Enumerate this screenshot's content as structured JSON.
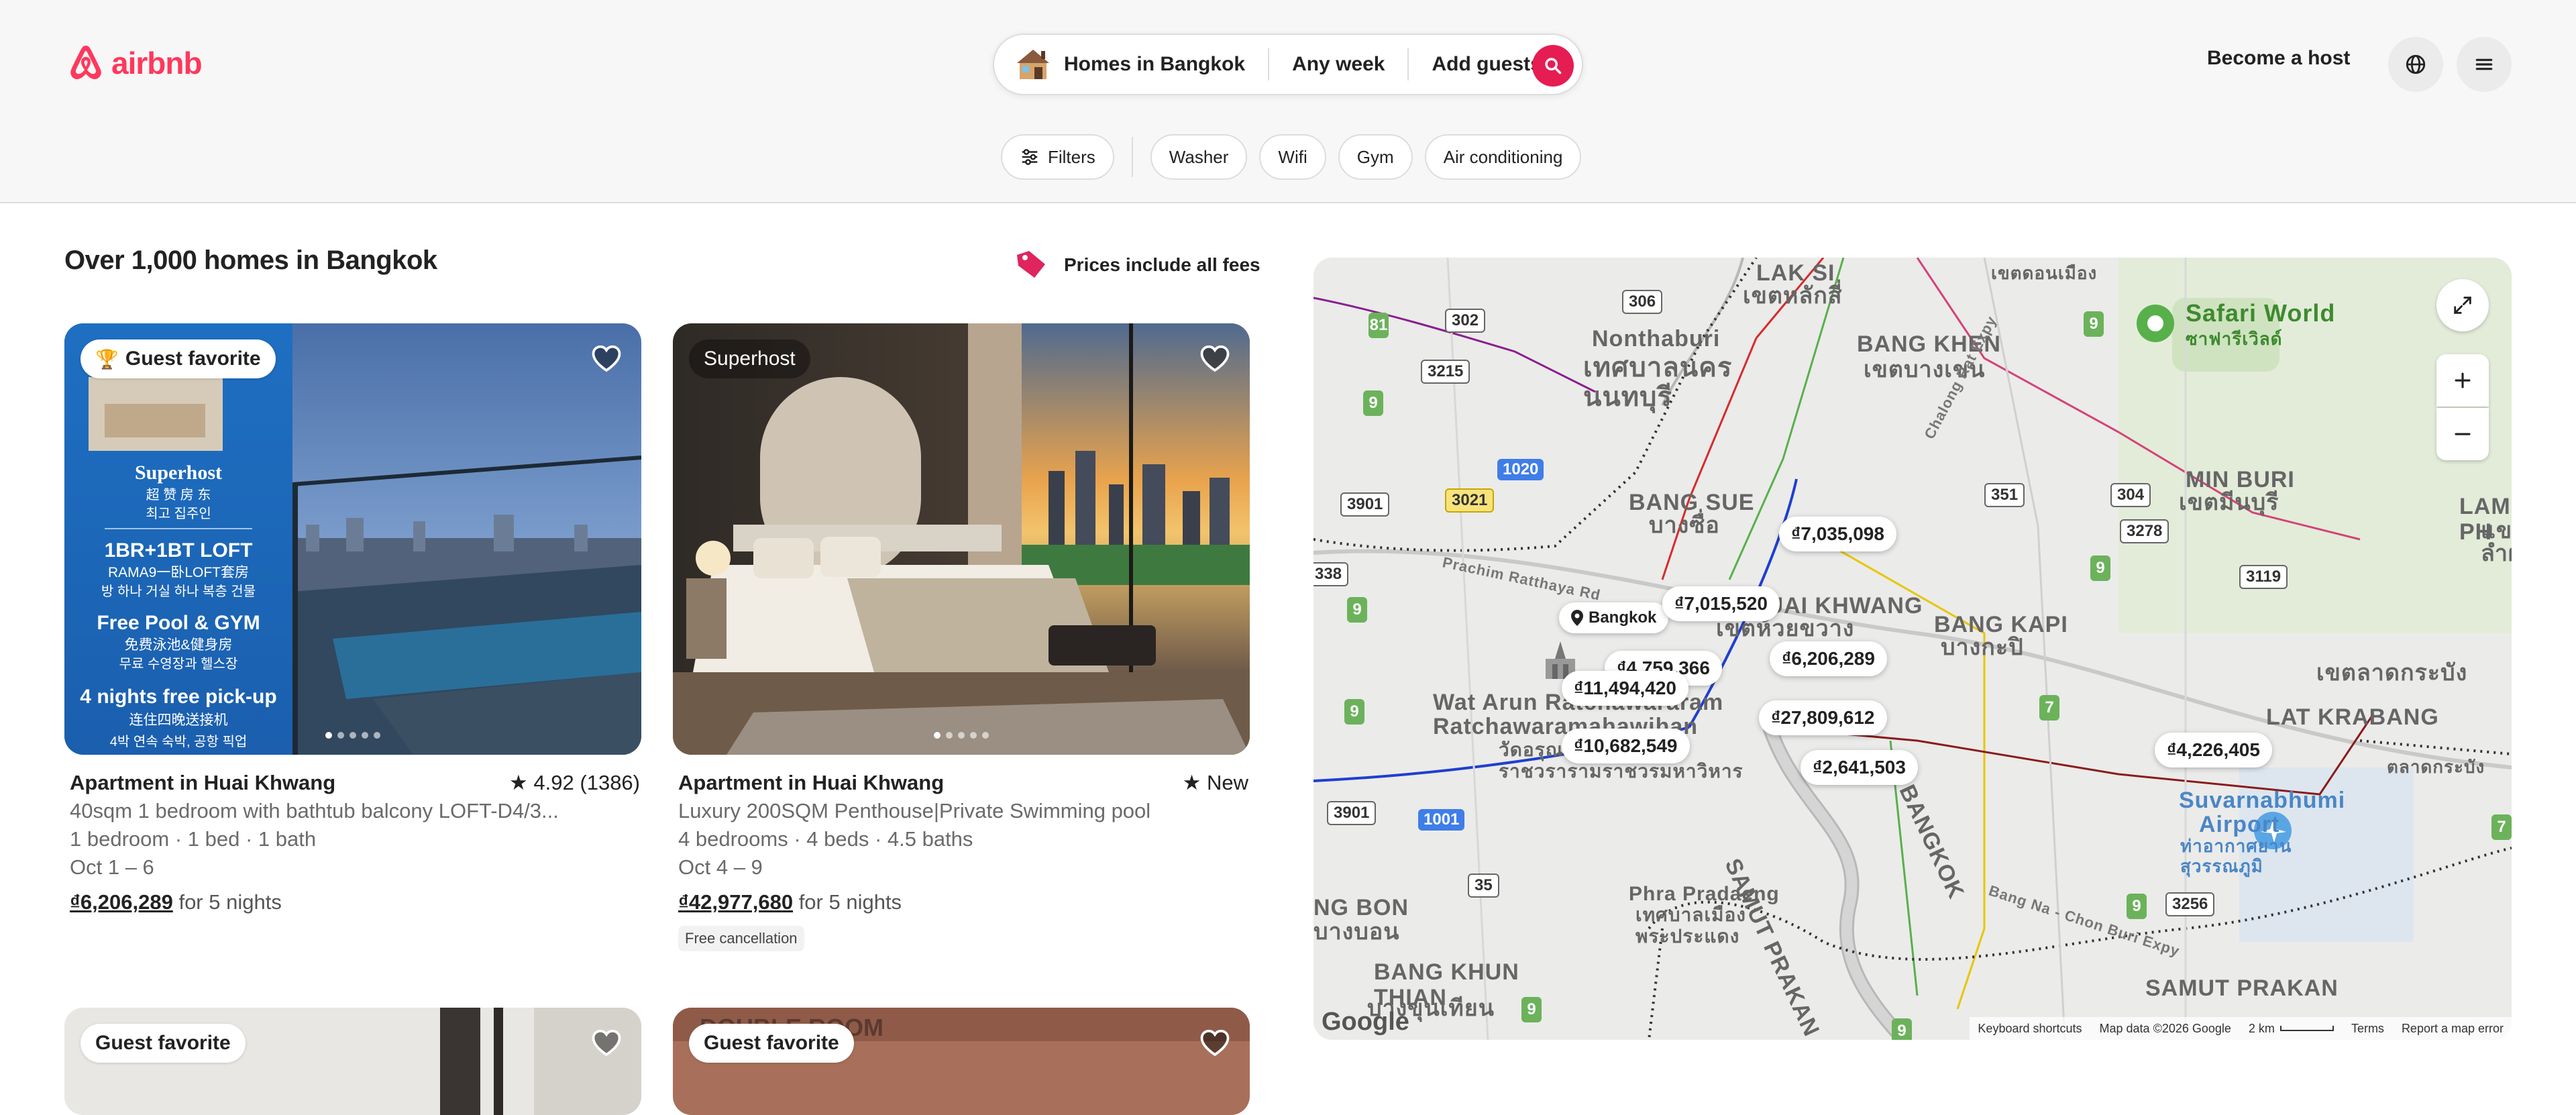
{
  "header": {
    "logo_text": "airbnb",
    "search": {
      "location": "Homes in Bangkok",
      "dates": "Any week",
      "guests": "Add guests"
    },
    "become_host": "Become a host"
  },
  "filters": {
    "filters_label": "Filters",
    "chips": [
      "Washer",
      "Wifi",
      "Gym",
      "Air conditioning"
    ]
  },
  "results": {
    "heading": "Over 1,000 homes in Bangkok",
    "fees_note": "Prices include all fees"
  },
  "listings": [
    {
      "badge": "Guest favorite",
      "title": "Apartment in Huai Khwang",
      "rating": "★ 4.92 (1386)",
      "description": "40sqm 1 bedroom with bathtub balcony LOFT-D4/3...",
      "details": "1 bedroom · 1 bed · 1 bath",
      "dates": "Oct 1 – 6",
      "price": "₫6,206,289",
      "price_suffix": "for 5 nights",
      "photo_text": {
        "superhost": "Superhost",
        "cn1": "超 赞 房 东",
        "kr1": "최고 집주인",
        "room": "1BR+1BT LOFT",
        "cn2": "RAMA9一卧LOFT套房",
        "kr2": "방 하나 거실 하나 복층 건물",
        "pool": "Free Pool & GYM",
        "cn3": "免费泳池&健身房",
        "kr3": "무료 수영장과 헬스장",
        "pickup": "4 nights free pick-up",
        "cn4": "连住四晚送接机",
        "kr4": "4박 연속 숙박, 공항 픽업"
      }
    },
    {
      "badge": "Superhost",
      "title": "Apartment in Huai Khwang",
      "rating": "★ New",
      "description": "Luxury 200SQM Penthouse|Private Swimming pool",
      "details": "4 bedrooms · 4 beds · 4.5 baths",
      "dates": "Oct 4 – 9",
      "price": "₫42,977,680",
      "price_suffix": "for 5 nights",
      "tag": "Free cancellation"
    },
    {
      "badge": "Guest favorite"
    },
    {
      "badge": "Guest favorite",
      "photo_text": "DOUBLE ROOM"
    }
  ],
  "map": {
    "prices": [
      "₫7,035,098",
      "₫7,015,520",
      "₫4,759,366",
      "₫6,206,289",
      "₫11,494,420",
      "₫27,809,612",
      "₫10,682,549",
      "₫2,641,503",
      "₫4,226,405"
    ],
    "place_chip": "Bangkok",
    "labels": {
      "nonthaburi": "Nonthaburi",
      "nonthaburi_th": "เทศบาลนคร\nนนทบุรี",
      "bang_khen": "BANG KHEN",
      "bang_khen_th": "เขตบางเขน",
      "lak_si": "LAK SI",
      "lak_si_th": "เขตหลักสี่",
      "safari": "Safari World",
      "safari_th": "ซาฟารีเวิลด์",
      "min_buri": "MIN BURI",
      "min_buri_th": "เขตมีนบุรี",
      "lam_ph": "LAM PH",
      "bang_sue": "BANG SUE",
      "bang_sue_th": "บางซื่อ",
      "huai_khwang": "HUAI KHWANG",
      "huai_khwang_th": "เขตห้วยขวาง",
      "bang_kapi": "BANG KAPI",
      "bang_kapi_th": "บางกะปิ",
      "lat_krabang": "LAT KRABANG",
      "lat_krabang_th": "เขตลาดกระบัง",
      "wat_arun": "Wat Arun Ratchawararam",
      "wat_arun2": "Ratchawaramahawihan",
      "wat_arun_th": "วัดอรุณ\nราชวรารามราชวรมหาวิหาร",
      "suvarnabhumi": "Suvarnabhumi",
      "suvarnabhumi2": "Airport",
      "suvarnabhumi_th": "ท่าอากาศยาน\nสุวรรณภูมิ",
      "samut_prakan_river": "SAMUT PRAKAN",
      "samut_prakan": "SAMUT PRAKAN",
      "phra_pradaeng": "Phra Pradaeng",
      "phra_pradaeng_th": "เทศบาลเมือง\nพระประแดง",
      "bang_khun_thian": "BANG KHUN\nTHIAN",
      "bang_khun_thian_th": "บางขุนเทียน",
      "bang_bon": "NG BON",
      "bang_bon_th": "บางบอน",
      "bangkok_river": "BANGKOK",
      "top_th": "เขตดอนเมือง",
      "lat_krabang_th2": "ตลาดกระบัง",
      "prachim": "Prachim Ratthaya Rd",
      "bang_na": "Bang Na - Chon Buri Expy",
      "chalong": "Chalong Rat Expy",
      "lam_ph_th": "แข\nลำผั"
    },
    "routes": [
      "81",
      "302",
      "306",
      "3215",
      "9",
      "9",
      "1020",
      "3021",
      "3901",
      "338",
      "351",
      "304",
      "3278",
      "9",
      "3119",
      "9",
      "7",
      "9",
      "3901",
      "1001",
      "35",
      "9",
      "3256",
      "9",
      "7",
      "9"
    ],
    "footer": {
      "shortcuts": "Keyboard shortcuts",
      "data": "Map data ©2026 Google",
      "scale": "2 km",
      "terms": "Terms",
      "report": "Report a map error"
    },
    "google": "Google"
  }
}
